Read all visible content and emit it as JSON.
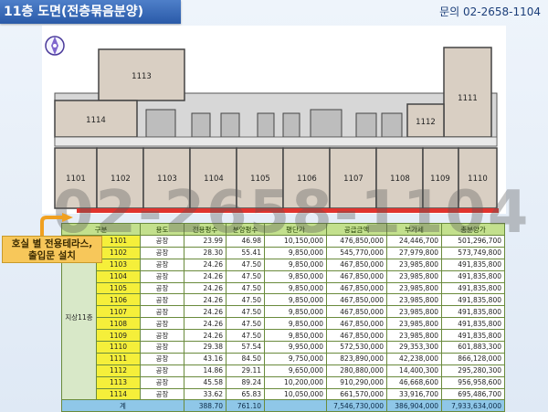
{
  "header": {
    "title": "11층 도면(전층묶음분양)",
    "contact": "문의 02-2658-1104"
  },
  "watermark": "02-2658-1104",
  "note": {
    "line1": "호실 별 전용테라스,",
    "line2": "출입문 설치"
  },
  "floorplan": {
    "top_units": [
      "1113",
      "1114",
      "1111",
      "1112"
    ],
    "bottom_units": [
      "1101",
      "1102",
      "1103",
      "1104",
      "1105",
      "1106",
      "1107",
      "1108",
      "1109",
      "1110"
    ]
  },
  "table": {
    "headers": [
      "구분",
      "용도",
      "전용평수",
      "분양평수",
      "평단가",
      "공급금액",
      "부가세",
      "총분양가"
    ],
    "floor_label": "지상11층",
    "rows": [
      [
        "1101",
        "공장",
        "23.99",
        "46.98",
        "10,150,000",
        "476,850,000",
        "24,446,700",
        "501,296,700"
      ],
      [
        "1102",
        "공장",
        "28.30",
        "55.41",
        "9,850,000",
        "545,770,000",
        "27,979,800",
        "573,749,800"
      ],
      [
        "1103",
        "공장",
        "24.26",
        "47.50",
        "9,850,000",
        "467,850,000",
        "23,985,800",
        "491,835,800"
      ],
      [
        "1104",
        "공장",
        "24.26",
        "47.50",
        "9,850,000",
        "467,850,000",
        "23,985,800",
        "491,835,800"
      ],
      [
        "1105",
        "공장",
        "24.26",
        "47.50",
        "9,850,000",
        "467,850,000",
        "23,985,800",
        "491,835,800"
      ],
      [
        "1106",
        "공장",
        "24.26",
        "47.50",
        "9,850,000",
        "467,850,000",
        "23,985,800",
        "491,835,800"
      ],
      [
        "1107",
        "공장",
        "24.26",
        "47.50",
        "9,850,000",
        "467,850,000",
        "23,985,800",
        "491,835,800"
      ],
      [
        "1108",
        "공장",
        "24.26",
        "47.50",
        "9,850,000",
        "467,850,000",
        "23,985,800",
        "491,835,800"
      ],
      [
        "1109",
        "공장",
        "24.26",
        "47.50",
        "9,850,000",
        "467,850,000",
        "23,985,800",
        "491,835,800"
      ],
      [
        "1110",
        "공장",
        "29.38",
        "57.54",
        "9,950,000",
        "572,530,000",
        "29,353,300",
        "601,883,300"
      ],
      [
        "1111",
        "공장",
        "43.16",
        "84.50",
        "9,750,000",
        "823,890,000",
        "42,238,000",
        "866,128,000"
      ],
      [
        "1112",
        "공장",
        "14.86",
        "29.11",
        "9,650,000",
        "280,880,000",
        "14,400,300",
        "295,280,300"
      ],
      [
        "1113",
        "공장",
        "45.58",
        "89.24",
        "10,200,000",
        "910,290,000",
        "46,668,600",
        "956,958,600"
      ],
      [
        "1114",
        "공장",
        "33.62",
        "65.83",
        "10,050,000",
        "661,570,000",
        "33,916,700",
        "695,486,700"
      ]
    ],
    "total": [
      "계",
      "388.70",
      "761.10",
      "",
      "7,546,730,000",
      "386,904,000",
      "7,933,634,000"
    ]
  },
  "colors": {
    "title_bg": "#2a5aa8",
    "header_bg": "#c3e08d",
    "unit_bg": "#f5ef3a",
    "total_bg": "#8fc7e8",
    "terrace_red": "#e0342f"
  }
}
